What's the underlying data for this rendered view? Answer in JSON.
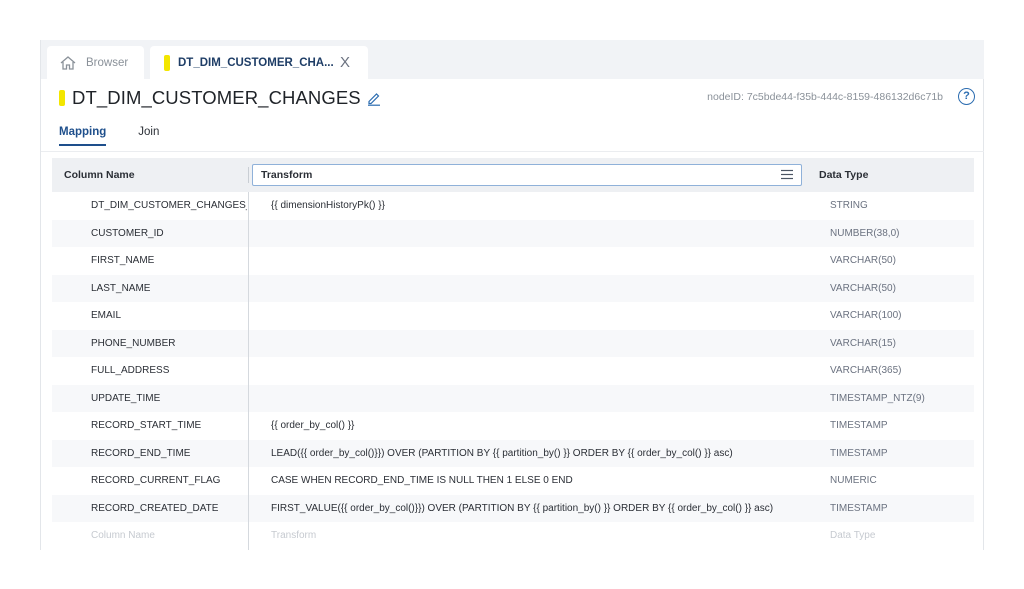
{
  "tabs": [
    {
      "label": "Browser",
      "icon": "home-icon"
    },
    {
      "label": "DT_DIM_CUSTOMER_CHA...",
      "close": "X"
    }
  ],
  "header": {
    "title": "DT_DIM_CUSTOMER_CHANGES",
    "node_id": "nodeID: 7c5bde44-f35b-444c-8159-486132d6c71b",
    "help": "?"
  },
  "subtabs": [
    "Mapping",
    "Join"
  ],
  "columns": {
    "name": "Column Name",
    "transform": "Transform",
    "type": "Data Type"
  },
  "rows": [
    {
      "name": "DT_DIM_CUSTOMER_CHANGES_KEY",
      "transform": "{{ dimensionHistoryPk() }}",
      "type": "STRING"
    },
    {
      "name": "CUSTOMER_ID",
      "transform": "",
      "type": "NUMBER(38,0)"
    },
    {
      "name": "FIRST_NAME",
      "transform": "",
      "type": "VARCHAR(50)"
    },
    {
      "name": "LAST_NAME",
      "transform": "",
      "type": "VARCHAR(50)"
    },
    {
      "name": "EMAIL",
      "transform": "",
      "type": "VARCHAR(100)"
    },
    {
      "name": "PHONE_NUMBER",
      "transform": "",
      "type": "VARCHAR(15)"
    },
    {
      "name": "FULL_ADDRESS",
      "transform": "",
      "type": "VARCHAR(365)"
    },
    {
      "name": "UPDATE_TIME",
      "transform": "",
      "type": "TIMESTAMP_NTZ(9)"
    },
    {
      "name": "RECORD_START_TIME",
      "transform": "{{ order_by_col() }}",
      "type": "TIMESTAMP"
    },
    {
      "name": "RECORD_END_TIME",
      "transform": "LEAD({{ order_by_col()}}) OVER (PARTITION BY {{ partition_by() }} ORDER BY {{ order_by_col() }} asc)",
      "type": "TIMESTAMP"
    },
    {
      "name": "RECORD_CURRENT_FLAG",
      "transform": "CASE WHEN RECORD_END_TIME IS NULL THEN 1 ELSE 0 END",
      "type": "NUMERIC"
    },
    {
      "name": "RECORD_CREATED_DATE",
      "transform": "FIRST_VALUE({{ order_by_col()}}) OVER (PARTITION BY {{ partition_by() }} ORDER BY {{ order_by_col() }} asc)",
      "type": "TIMESTAMP"
    }
  ],
  "new_row": {
    "name": "Column Name",
    "transform": "Transform",
    "type": "Data Type"
  },
  "colors": {
    "accent": "#1e4f8c",
    "marker": "#f3e600",
    "help": "#2b6cb0"
  }
}
